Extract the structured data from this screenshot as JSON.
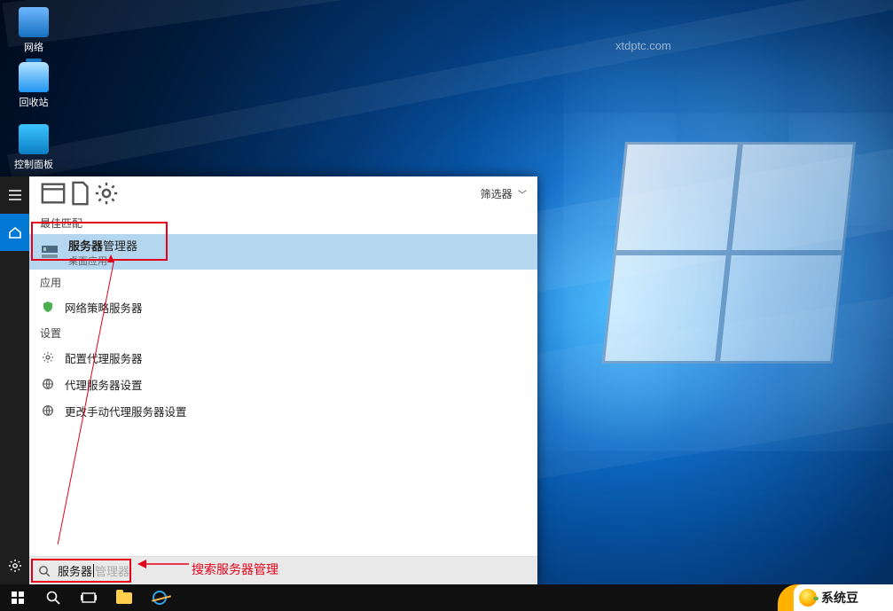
{
  "desktop_icons": {
    "network": "网络",
    "recycle_bin": "回收站",
    "control_panel": "控制面板"
  },
  "search_panel": {
    "filter_label": "筛选器",
    "sections": {
      "best_match": "最佳匹配",
      "apps": "应用",
      "settings": "设置"
    },
    "best_match_item": {
      "title_bold": "服务器",
      "title_rest": "管理器",
      "subtitle": "桌面应用"
    },
    "app_items": [
      "网络策略服务器"
    ],
    "setting_items": [
      "配置代理服务器",
      "代理服务器设置",
      "更改手动代理服务器设置"
    ],
    "search_input": {
      "typed": "服务器",
      "placeholder_tail": "管理器"
    }
  },
  "annotations": {
    "search_hint": "搜索服务器管理"
  },
  "watermark": "xtdptc.com",
  "brand": "系统豆"
}
